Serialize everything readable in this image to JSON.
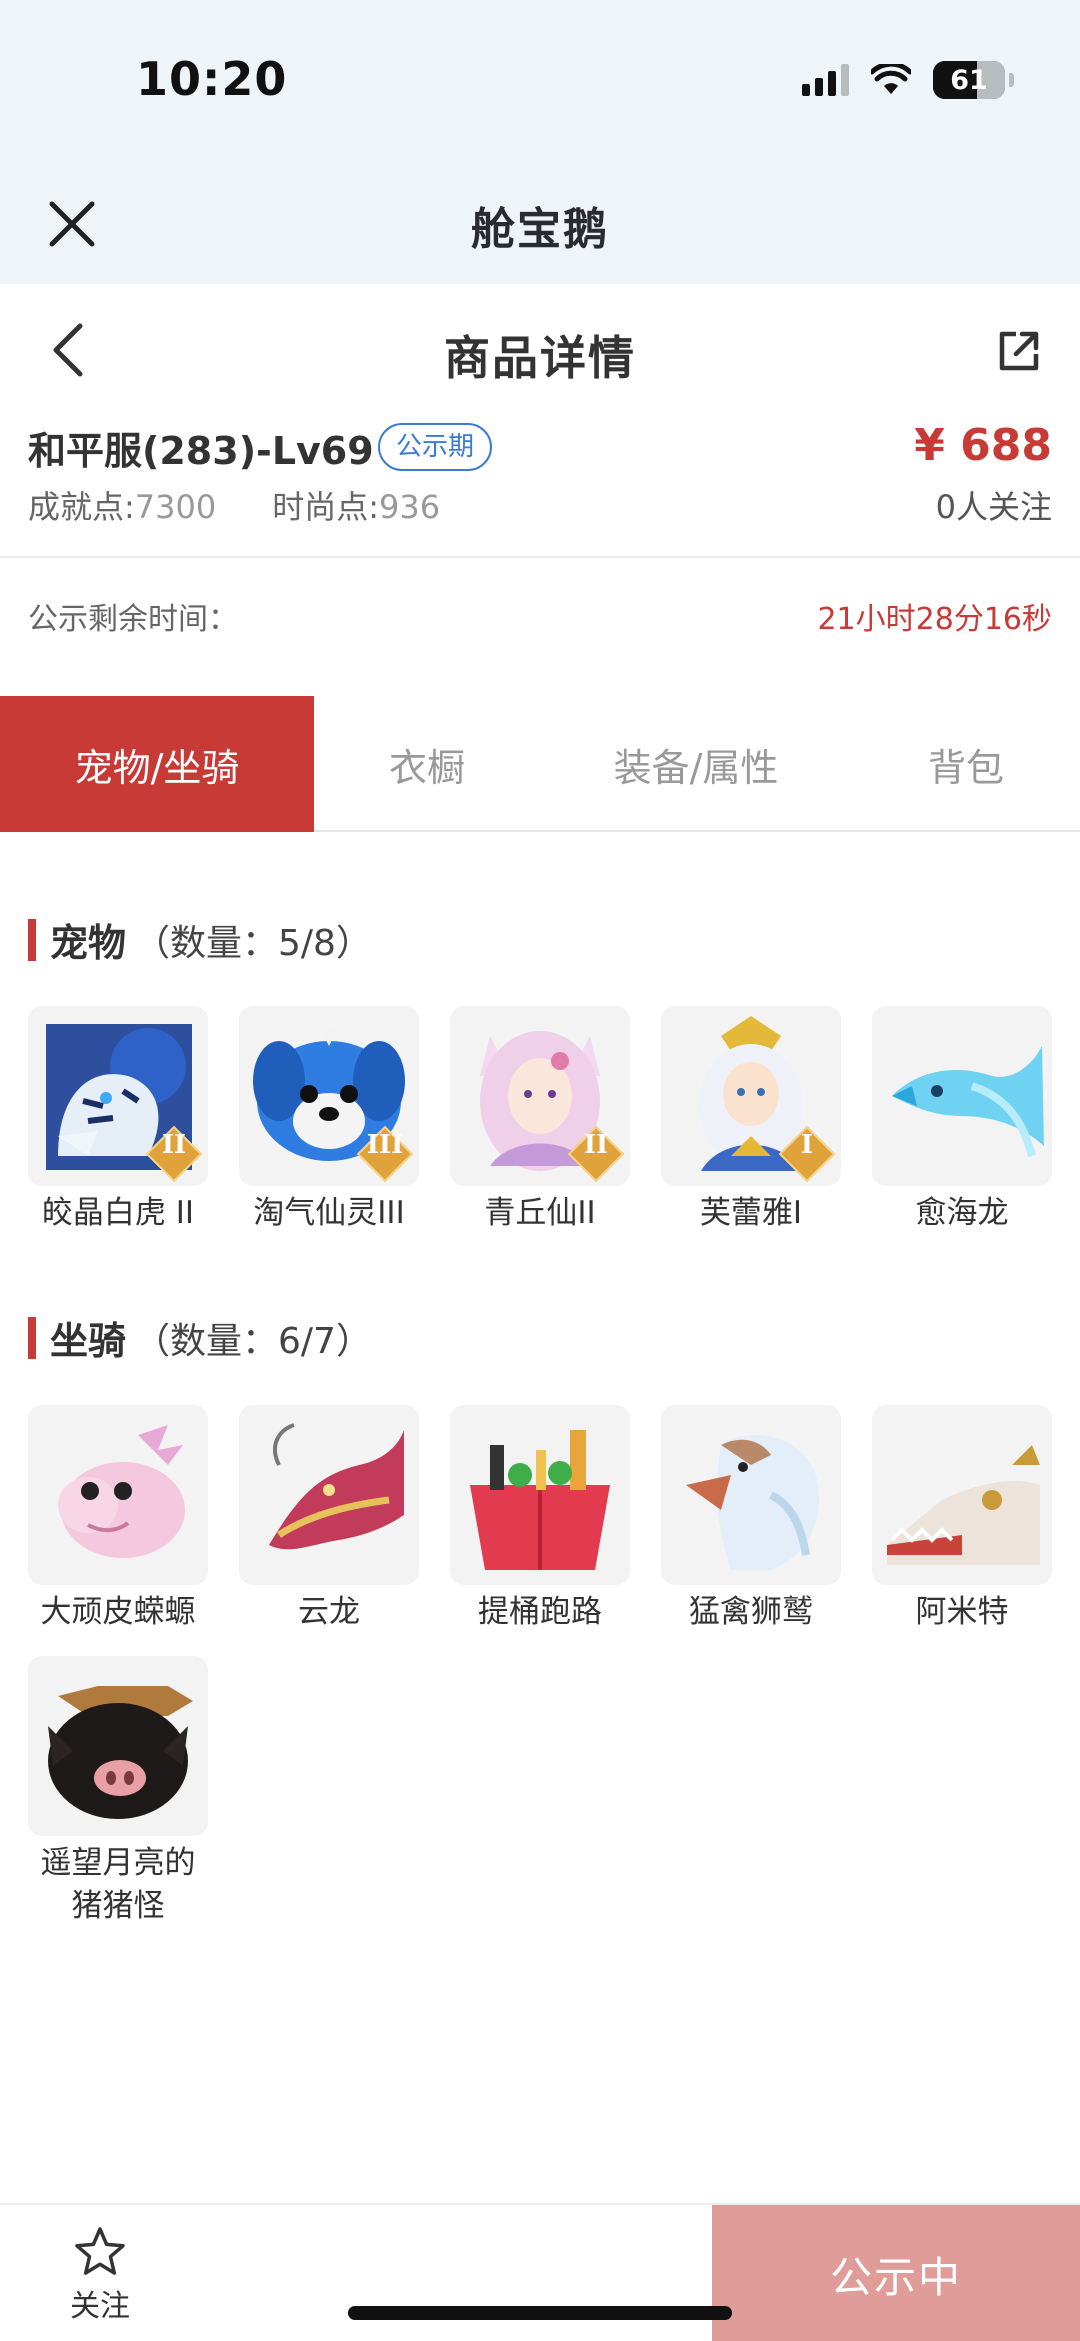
{
  "status_bar": {
    "time": "10:20",
    "battery": "61"
  },
  "app_bar": {
    "title": "舱宝鹅"
  },
  "page_header": {
    "title": "商品详情"
  },
  "item": {
    "title": "和平服(283)-Lv69",
    "tag": "公示期",
    "price": "¥ 688",
    "followers": "0人关注",
    "achievement_label": "成就点:",
    "achievement_value": "7300",
    "fashion_label": "时尚点:",
    "fashion_value": "936"
  },
  "publicity": {
    "label": "公示剩余时间：",
    "value": "21小时28分16秒"
  },
  "tabs": [
    {
      "label": "宠物/坐骑",
      "active": true
    },
    {
      "label": "衣橱",
      "active": false
    },
    {
      "label": "装备/属性",
      "active": false
    },
    {
      "label": "背包",
      "active": false
    }
  ],
  "pets": {
    "title": "宠物",
    "count": "（数量：5/8）",
    "items": [
      {
        "name": "皎晶白虎 II",
        "rank": "II",
        "icon": "white-tiger-icon"
      },
      {
        "name": "淘气仙灵III",
        "rank": "III",
        "icon": "blue-puppy-icon"
      },
      {
        "name": "青丘仙II",
        "rank": "II",
        "icon": "fox-fairy-icon"
      },
      {
        "name": "芙蕾雅I",
        "rank": "I",
        "icon": "golden-warrior-icon"
      },
      {
        "name": "愈海龙",
        "rank": "",
        "icon": "sea-dragon-icon"
      }
    ]
  },
  "mounts": {
    "title": "坐骑",
    "count": "（数量：6/7）",
    "items": [
      {
        "name": "大顽皮蝾螈",
        "icon": "axolotl-icon"
      },
      {
        "name": "云龙",
        "icon": "cloud-dragon-icon"
      },
      {
        "name": "提桶跑路",
        "icon": "bucket-icon"
      },
      {
        "name": "猛禽狮鹫",
        "icon": "griffin-icon"
      },
      {
        "name": "阿米特",
        "icon": "crocodile-icon"
      },
      {
        "name": "遥望月亮的猪猪怪",
        "icon": "pig-icon"
      }
    ]
  },
  "bottom_bar": {
    "follow_label": "关注",
    "status_label": "公示中"
  },
  "colors": {
    "accent": "#c83a35",
    "tag_blue": "#3a7bd5",
    "disabled_button": "#e09c99",
    "top_bg": "#eff4f8"
  }
}
